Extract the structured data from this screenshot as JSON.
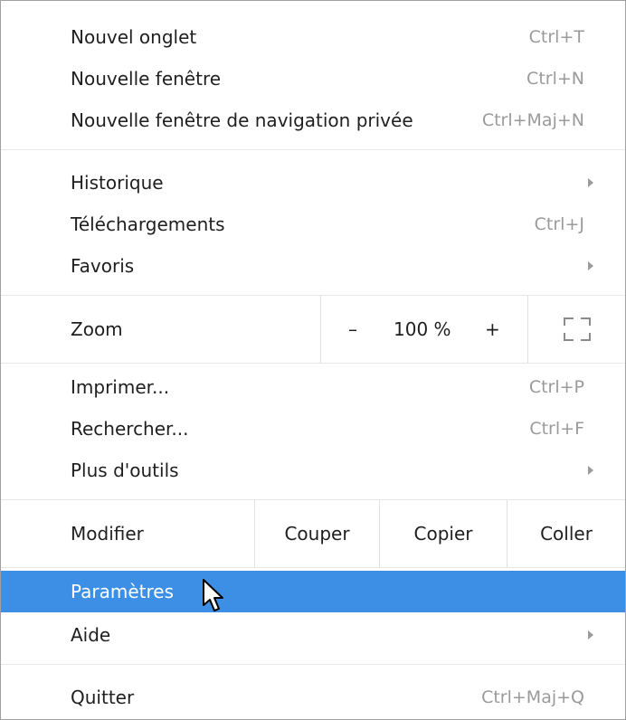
{
  "menu": {
    "new_tab": {
      "label": "Nouvel onglet",
      "shortcut": "Ctrl+T"
    },
    "new_window": {
      "label": "Nouvelle fenêtre",
      "shortcut": "Ctrl+N"
    },
    "incognito": {
      "label": "Nouvelle fenêtre de navigation privée",
      "shortcut": "Ctrl+Maj+N"
    },
    "history": {
      "label": "Historique"
    },
    "downloads": {
      "label": "Téléchargements",
      "shortcut": "Ctrl+J"
    },
    "bookmarks": {
      "label": "Favoris"
    },
    "zoom": {
      "label": "Zoom",
      "minus": "–",
      "value": "100 %",
      "plus": "+"
    },
    "print": {
      "label": "Imprimer...",
      "shortcut": "Ctrl+P"
    },
    "find": {
      "label": "Rechercher...",
      "shortcut": "Ctrl+F"
    },
    "more_tools": {
      "label": "Plus d'outils"
    },
    "edit": {
      "label": "Modifier",
      "cut": "Couper",
      "copy": "Copier",
      "paste": "Coller"
    },
    "settings": {
      "label": "Paramètres"
    },
    "help": {
      "label": "Aide"
    },
    "quit": {
      "label": "Quitter",
      "shortcut": "Ctrl+Maj+Q"
    }
  },
  "colors": {
    "highlight": "#3d8fe6",
    "shortcut_text": "#9a9a9a",
    "separator": "#e6e6e6"
  },
  "icons": {
    "submenu_arrow": "chevron-right-icon",
    "fullscreen": "fullscreen-icon",
    "cursor": "mouse-pointer-icon"
  }
}
